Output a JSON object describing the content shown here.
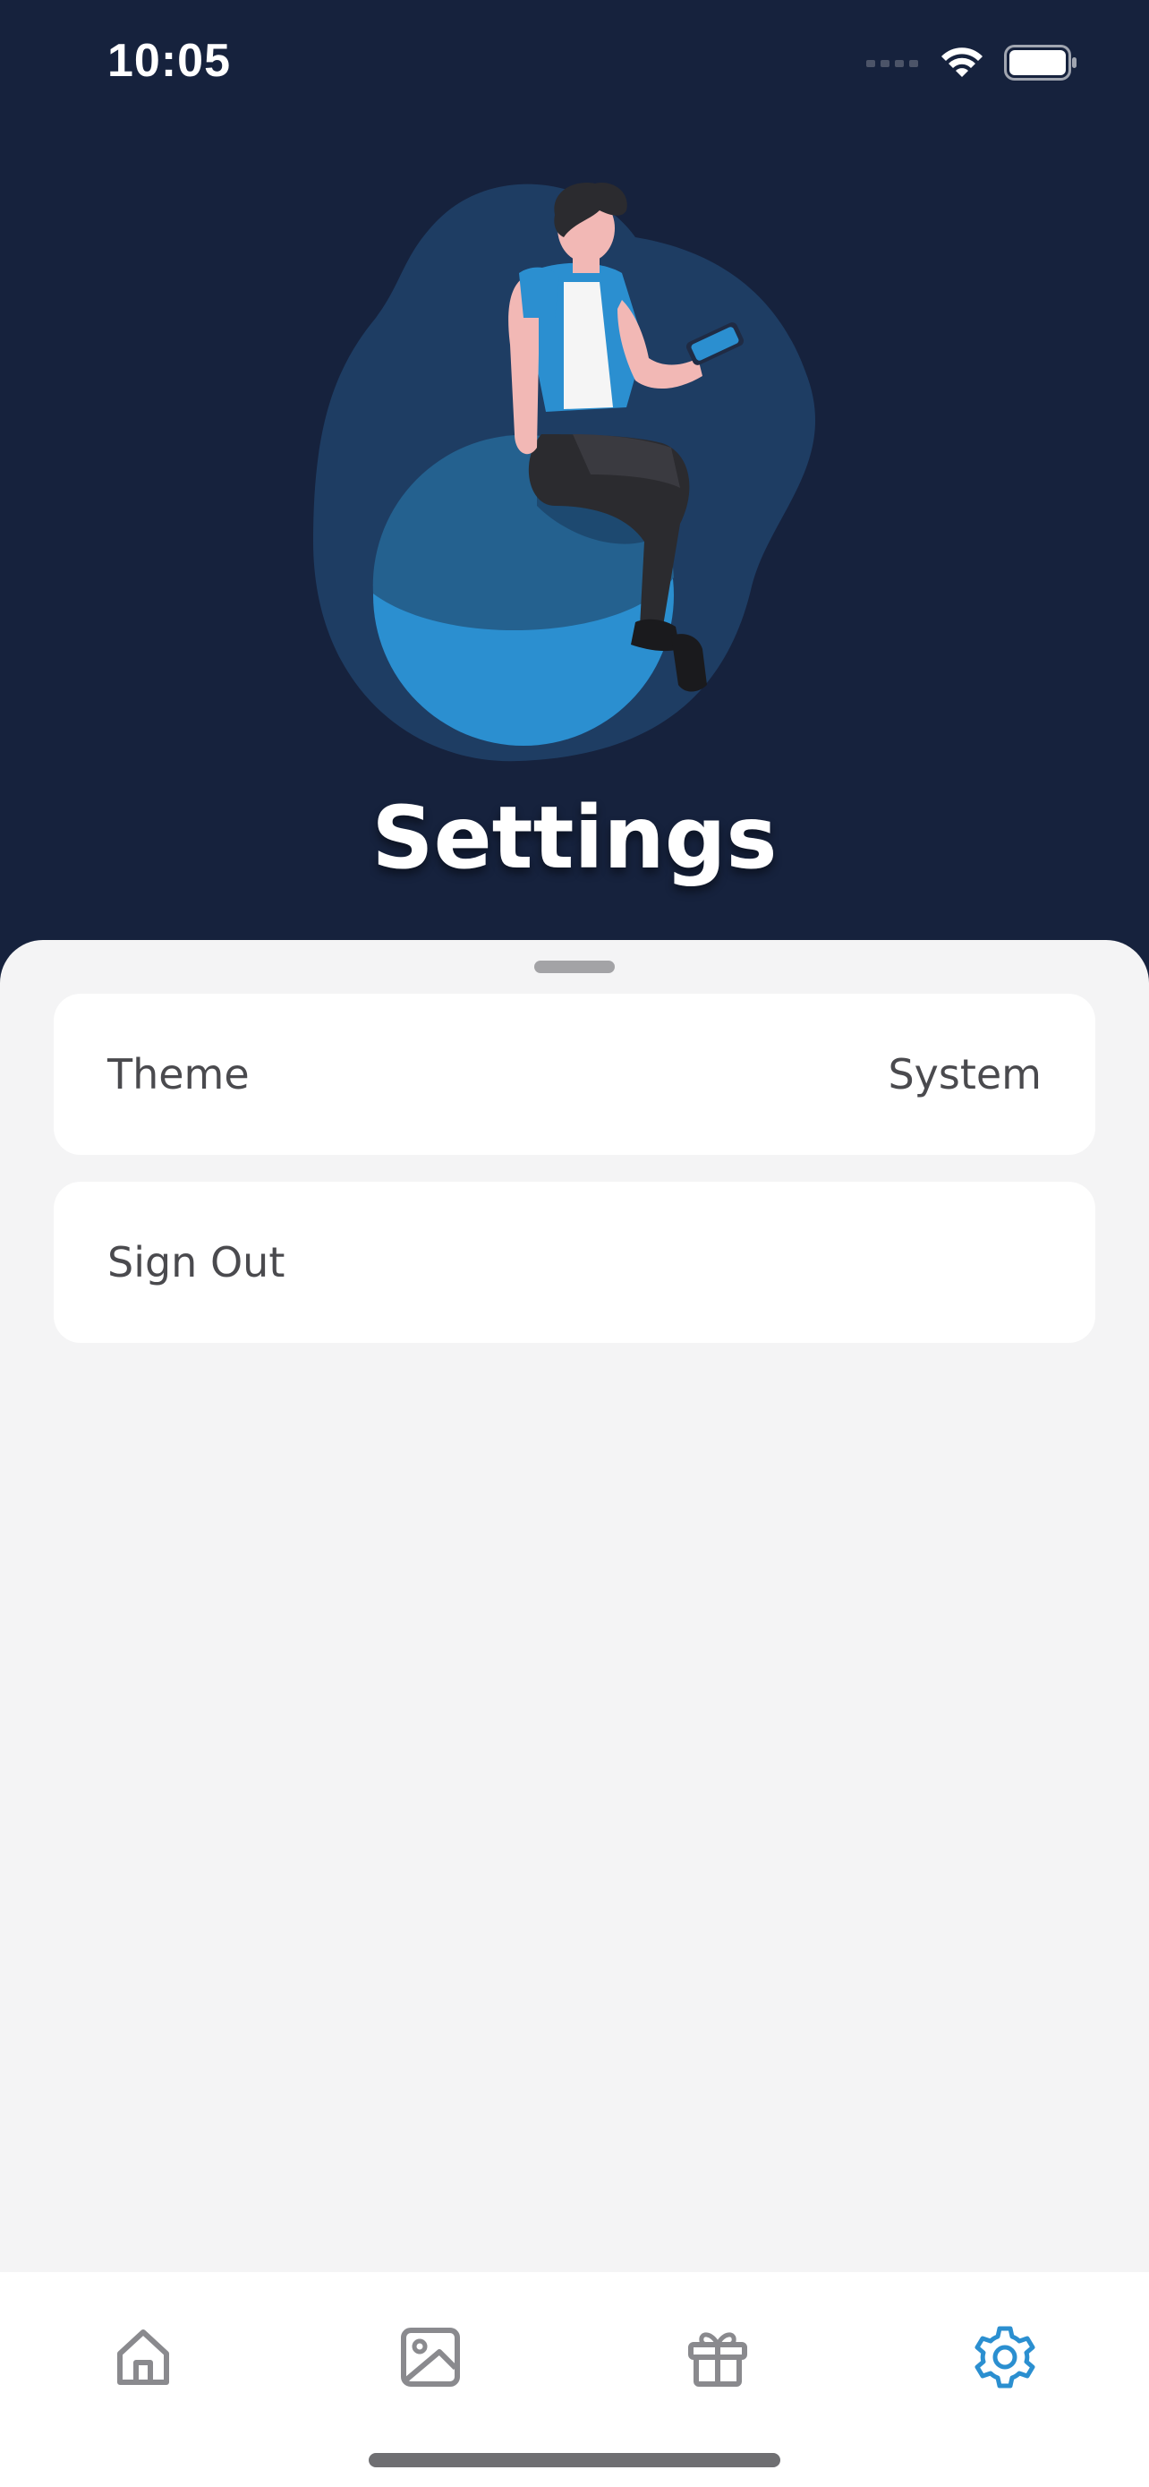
{
  "status_bar": {
    "time": "10:05",
    "icons": [
      "signal-icon",
      "wifi-icon",
      "battery-icon"
    ]
  },
  "header": {
    "title": "Settings",
    "illustration": "person-sitting-on-sphere-with-phone"
  },
  "settings": {
    "items": [
      {
        "label": "Theme",
        "value": "System"
      },
      {
        "label": "Sign Out",
        "value": ""
      }
    ]
  },
  "tab_bar": {
    "tabs": [
      {
        "icon": "home-icon",
        "active": false
      },
      {
        "icon": "image-icon",
        "active": false
      },
      {
        "icon": "gift-icon",
        "active": false
      },
      {
        "icon": "gear-icon",
        "active": true
      }
    ]
  },
  "colors": {
    "header_background": "#16223d",
    "sheet_background": "#f4f4f5",
    "card_background": "#ffffff",
    "accent": "#2b8fd0",
    "tab_inactive": "#8a8a8e",
    "text": "#4a4a4e"
  }
}
